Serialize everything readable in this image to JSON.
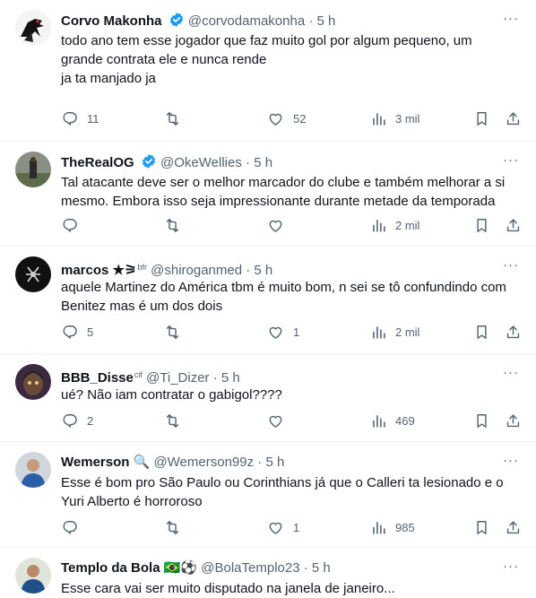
{
  "tweets": [
    {
      "name": "Corvo Makonha",
      "handle": "@corvodamakonha",
      "time": "5 h",
      "lines": [
        "todo ano tem esse jogador que faz muito gol por algum pequeno, um",
        "grande contrata ele e nunca rende",
        "ja ta manjado ja"
      ],
      "replies": "11",
      "retweets": "",
      "likes": "52",
      "views": "3 mil"
    },
    {
      "name": "TheRealOG",
      "handle": "@OkeWellies",
      "time": "5 h",
      "lines": [
        "Tal atacante deve ser o melhor marcador do clube e também melhorar a si",
        "mesmo. Embora isso seja impressionante durante metade da temporada"
      ],
      "replies": "",
      "retweets": "",
      "likes": "",
      "views": "2 mil"
    },
    {
      "name": "marcos ★⚞",
      "name_badge": "bfr",
      "handle": "@shiroganmed",
      "time": "5 h",
      "lines": [
        "aquele Martinez do América tbm é muito bom, n sei se tô confundindo com",
        "Benitez mas é um dos dois"
      ],
      "replies": "5",
      "retweets": "",
      "likes": "1",
      "views": "2 mil"
    },
    {
      "name": "BBB_Disse",
      "name_badge": "cif",
      "handle": "@Ti_Dizer",
      "time": "5 h",
      "lines": [
        "ué? Não iam contratar o gabigol????"
      ],
      "replies": "2",
      "retweets": "",
      "likes": "",
      "views": "469"
    },
    {
      "name": "Wemerson 🔍",
      "handle": "@Wemerson99z",
      "time": "5 h",
      "lines": [
        "Esse é bom pro São Paulo ou Corinthians já que o Calleri ta lesionado e o",
        "Yuri Alberto é horroroso"
      ],
      "replies": "",
      "retweets": "",
      "likes": "1",
      "views": "985"
    },
    {
      "name": "Templo da Bola 🇧🇷⚽",
      "handle": "@BolaTemplo23",
      "time": "5 h",
      "lines": [
        "Esse cara vai ser muito disputado na janela de janeiro..."
      ]
    }
  ],
  "separator": "·",
  "colors": {
    "text": "#0f1419",
    "muted": "#536471",
    "verified": "#1d9bf0",
    "border": "#eff3f4"
  }
}
